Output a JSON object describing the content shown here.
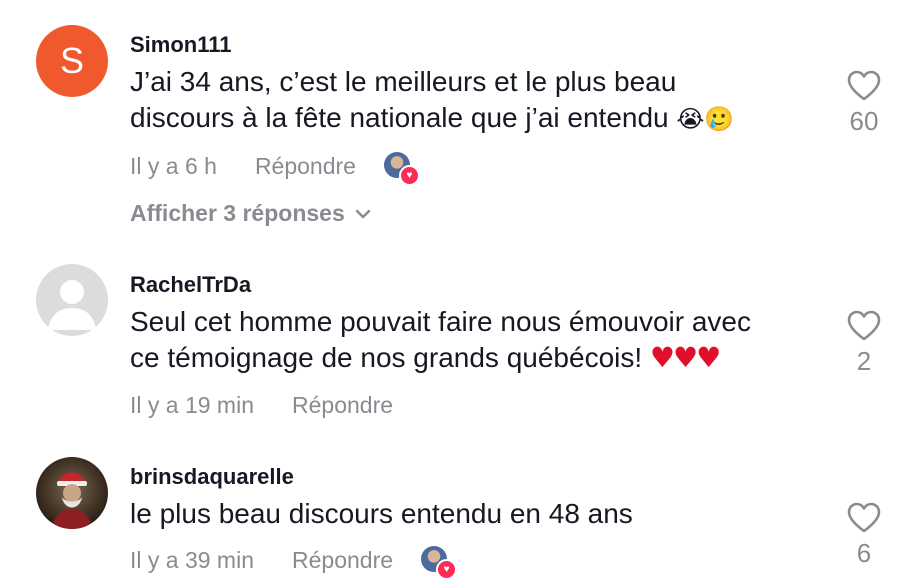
{
  "comments": [
    {
      "avatar_letter": "S",
      "avatar_color": "#f0582d",
      "username": "Simon111",
      "text_line1": "J’ai 34 ans, c’est le meilleurs et le plus beau",
      "text_line2": "discours à la fête nationale que j’ai entendu ",
      "emoji": "😭🥲",
      "time": "Il y a 6 h",
      "reply_label": "Répondre",
      "likes": "60",
      "view_replies": "Afficher 3 réponses"
    },
    {
      "username": "RachelTrDa",
      "text_line1": "Seul cet homme pouvait faire nous émouvoir avec",
      "text_line2": "ce témoignage de nos grands québécois! ",
      "emoji": "♥♥♥",
      "time": "Il y a 19 min",
      "reply_label": "Répondre",
      "likes": "2"
    },
    {
      "username": "brinsdaquarelle",
      "text_line1": "le plus beau discours entendu en 48 ans",
      "time": "Il y a 39 min",
      "reply_label": "Répondre",
      "likes": "6"
    }
  ],
  "icons": {
    "like": "heart-outline-icon",
    "chevron": "chevron-down-icon",
    "liked_by_creator": "heart-badge-icon"
  },
  "colors": {
    "accent_red": "#fe2c55",
    "meta_gray": "#8a8b91"
  }
}
